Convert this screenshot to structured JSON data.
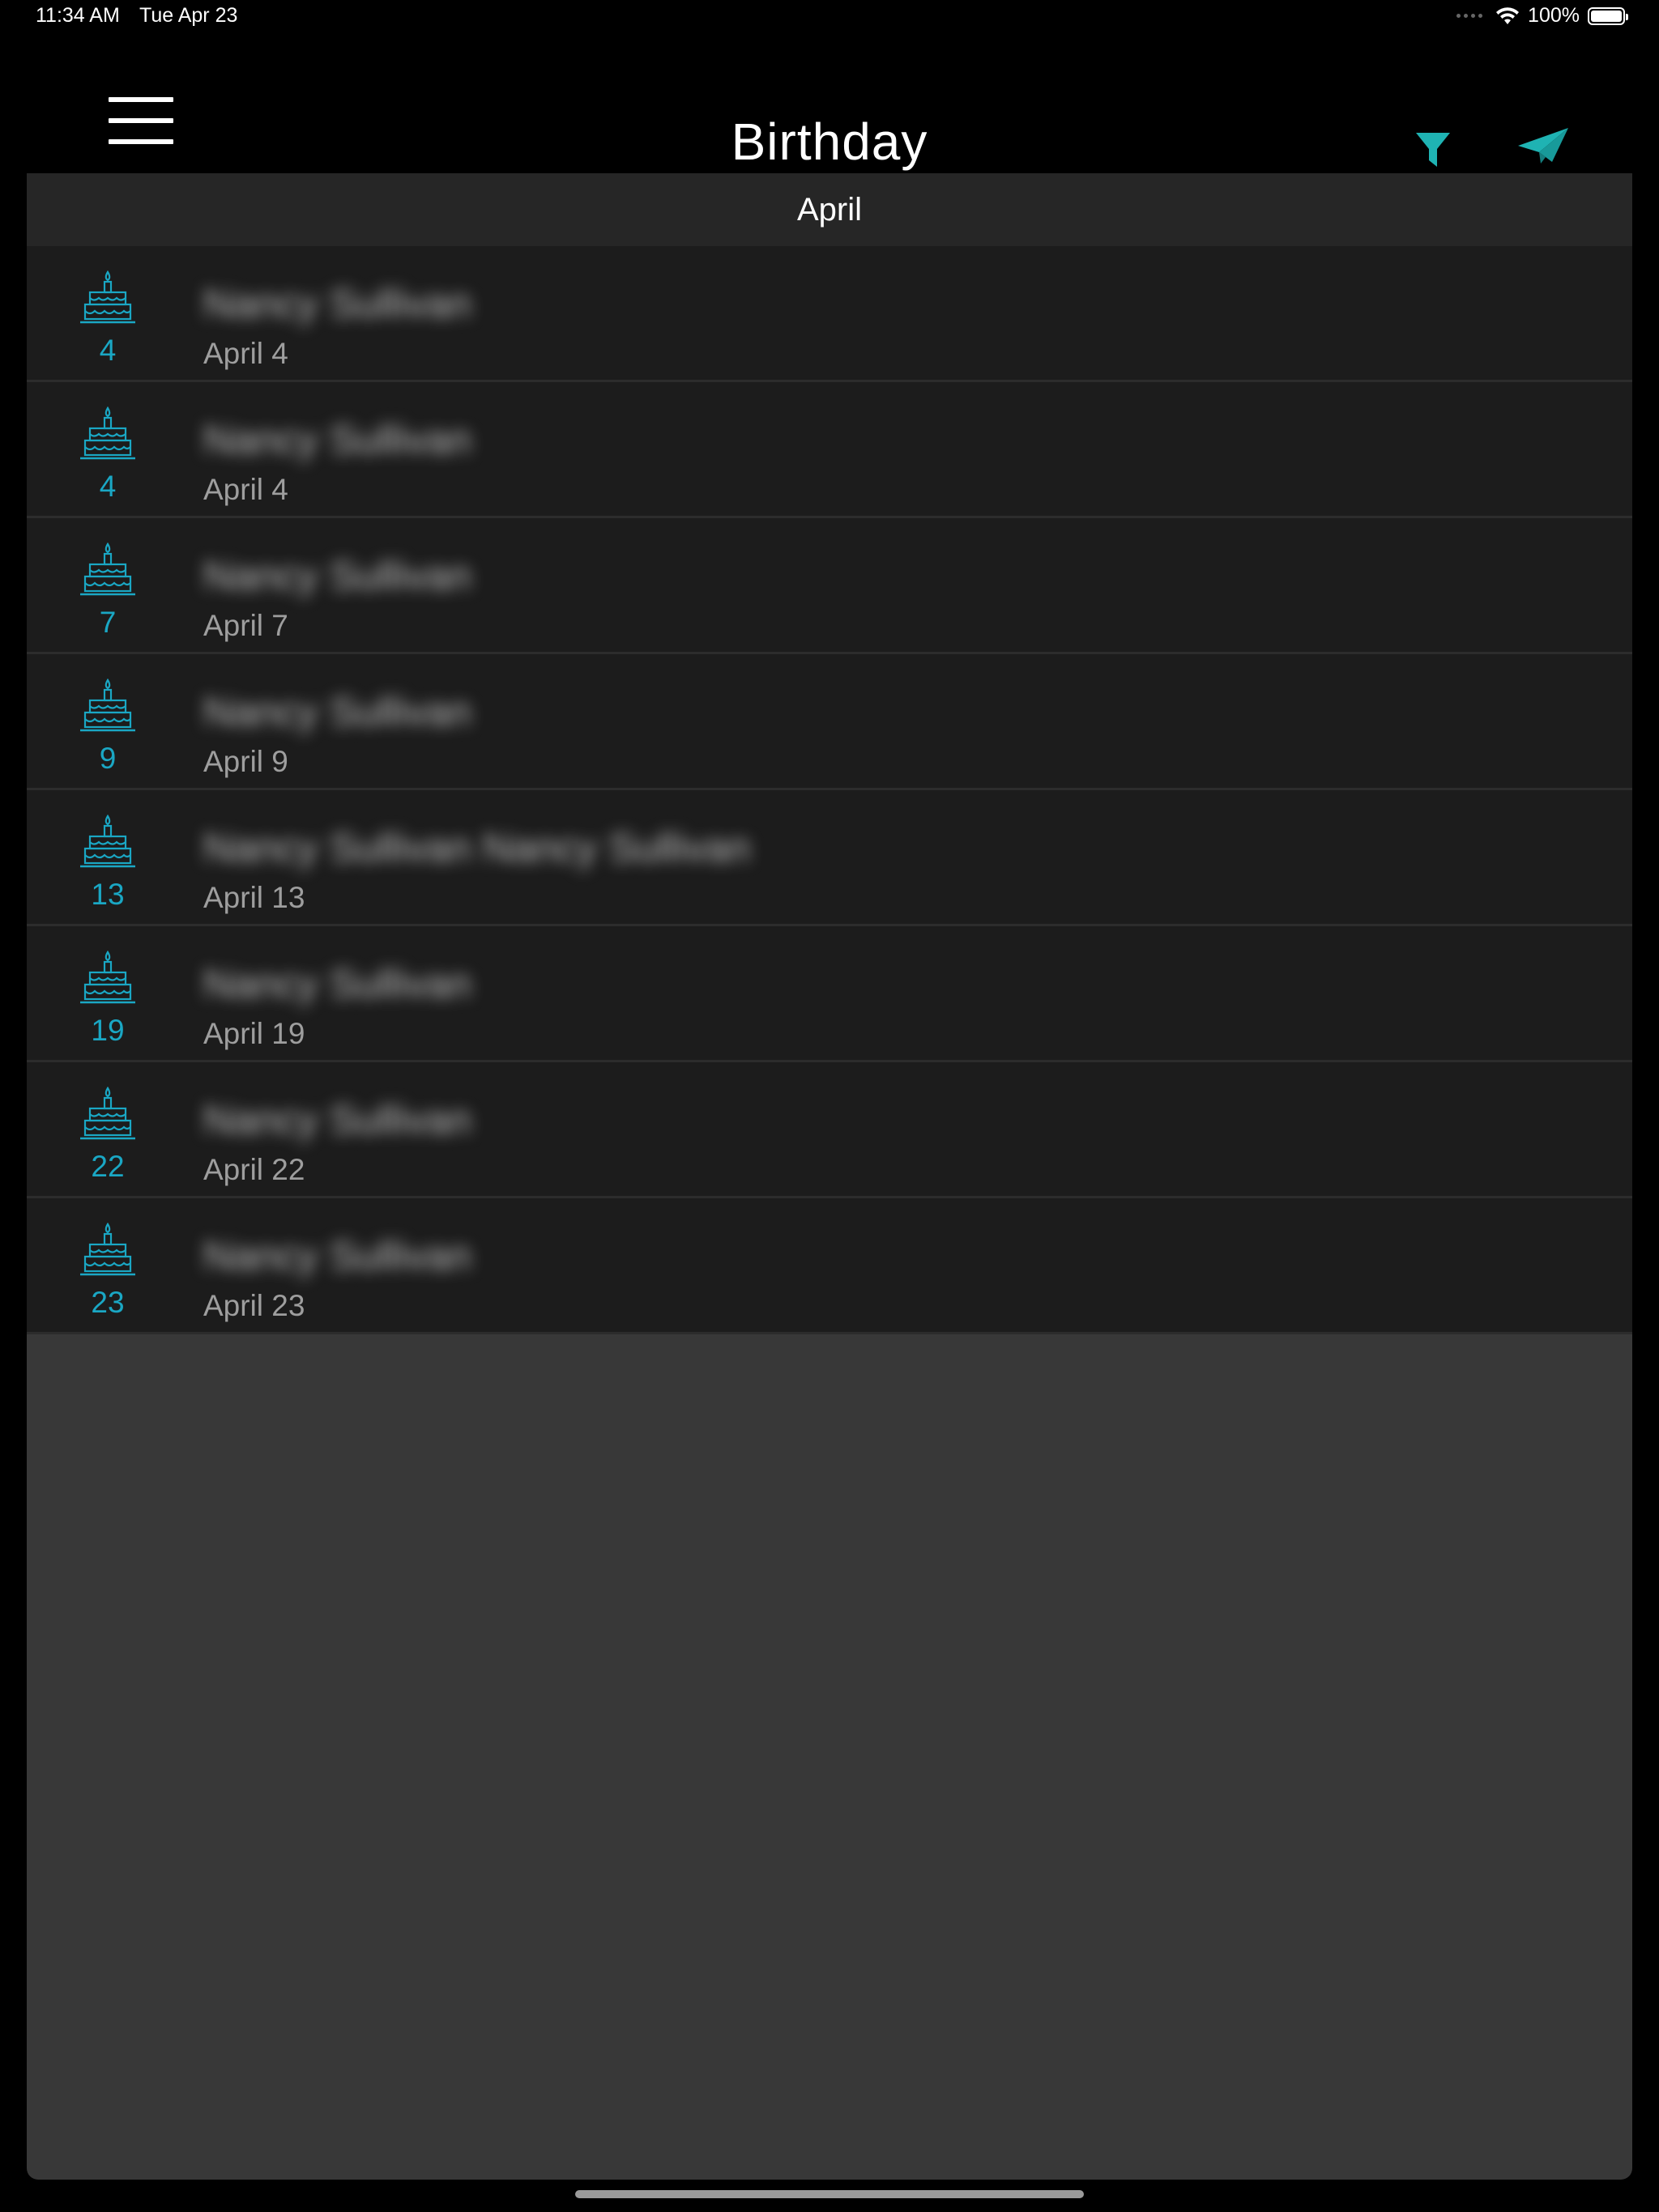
{
  "status_bar": {
    "time": "11:34 AM",
    "date": "Tue Apr 23",
    "battery": "100%"
  },
  "nav": {
    "title": "Birthday",
    "menu_icon": "hamburger-menu-icon",
    "filter_icon": "filter-funnel-icon",
    "send_icon": "paper-plane-icon",
    "accent_color": "#1fb3b3"
  },
  "section": {
    "month": "April"
  },
  "rows": [
    {
      "day": "4",
      "name": "Nancy Sullivan",
      "date": "April 4"
    },
    {
      "day": "4",
      "name": "Nancy Sullivan",
      "date": "April 4"
    },
    {
      "day": "7",
      "name": "Nancy Sullivan",
      "date": "April 7"
    },
    {
      "day": "9",
      "name": "Nancy Sullivan",
      "date": "April 9"
    },
    {
      "day": "13",
      "name": "Nancy Sullivan   Nancy Sullivan",
      "date": "April 13"
    },
    {
      "day": "19",
      "name": "Nancy Sullivan",
      "date": "April 19"
    },
    {
      "day": "22",
      "name": "Nancy Sullivan",
      "date": "April 22"
    },
    {
      "day": "23",
      "name": "Nancy Sullivan",
      "date": "April 23"
    }
  ],
  "row_icon": "birthday-cake-icon",
  "day_color": "#1aa7c4"
}
